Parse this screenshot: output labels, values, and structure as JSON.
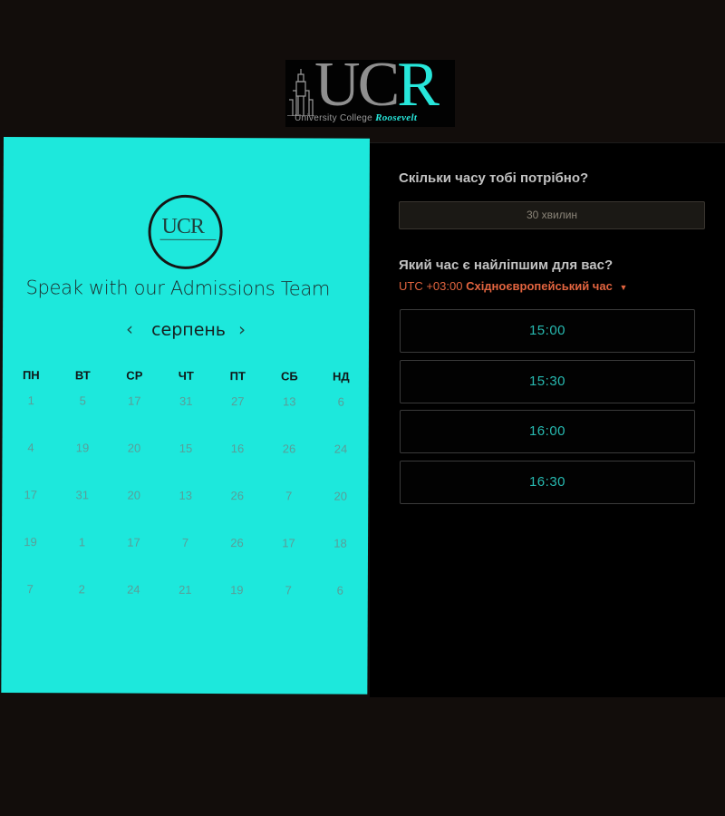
{
  "brand": {
    "logo_letters": [
      "U",
      "C",
      "R"
    ],
    "logo_subtitle": "University College",
    "logo_subtitle_accent": "Roosevelt",
    "accent_color": "#1de8dc",
    "text_accent_color": "#e2643f"
  },
  "left": {
    "small_logo_text": "UCR",
    "headline": "Speak with our Admissions Team",
    "month": "серпень",
    "prev_icon": "chevron-left-icon",
    "next_icon": "chevron-right-icon",
    "weekdays": [
      "ПН",
      "ВТ",
      "СР",
      "ЧТ",
      "ПТ",
      "СБ",
      "НД"
    ],
    "days": [
      "1",
      "5",
      "17",
      "31",
      "27",
      "13",
      "6",
      "4",
      "19",
      "20",
      "15",
      "16",
      "26",
      "24",
      "17",
      "31",
      "20",
      "13",
      "26",
      "7",
      "20",
      "19",
      "1",
      "17",
      "7",
      "26",
      "17",
      "18",
      "7",
      "2",
      "24",
      "21",
      "19",
      "7",
      "6"
    ]
  },
  "right": {
    "duration_question": "Скільки часу тобі потрібно?",
    "duration_value": "30 хвилин",
    "time_question": "Який час є найліпшим для вас?",
    "tz_offset": "UTC +03:00",
    "tz_name": "Східноєвропейський час",
    "tz_caret_icon": "caret-down-icon",
    "slots": [
      "15:00",
      "15:30",
      "16:00",
      "16:30"
    ]
  }
}
